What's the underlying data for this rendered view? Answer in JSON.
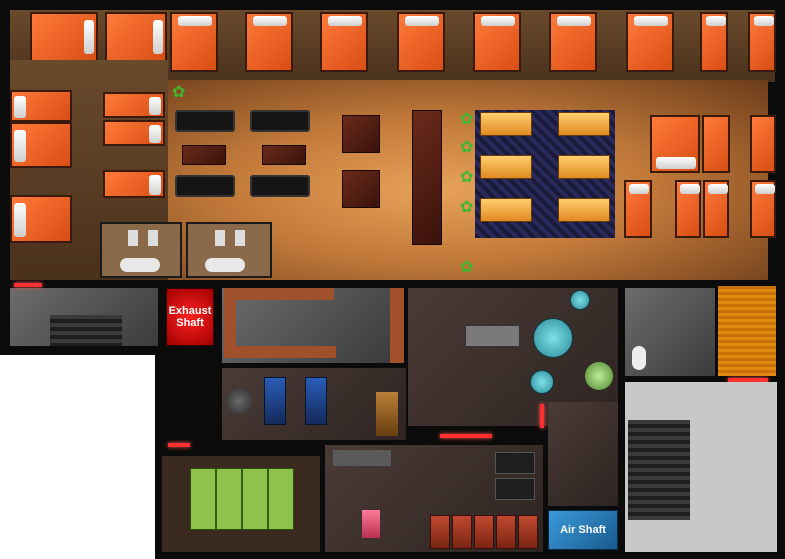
{
  "map": {
    "labels": {
      "exhaust_shaft": "Exhaust Shaft",
      "air_shaft": "Air Shaft"
    },
    "colors": {
      "wall": "#0b0b0b",
      "bed": "#e25a1c",
      "lounge_floor": "#d38b46",
      "exhaust": "#e01010",
      "air_shaft": "#2a7fb8",
      "office": "#e08a10"
    },
    "icons": {
      "plant": "potted-plant-icon",
      "toilet": "toilet-icon",
      "stairs": "stairs-icon"
    }
  }
}
